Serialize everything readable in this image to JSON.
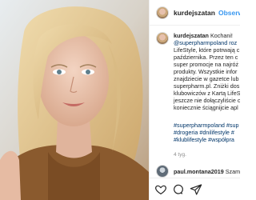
{
  "post": {
    "username": "kurdejszatan",
    "follow_label": "Obserw"
  },
  "caption": {
    "username": "kurdejszatan",
    "lines": [
      "Kochani!",
      "@superpharmpoland roz",
      "LifeStyle, które potrwają c",
      "października. Przez ten c",
      "super promocje na najróż",
      "produkty. Wszystkie infor",
      "znajdziecie w gazetce lub",
      "superpharm.pl. Zniżki dos",
      "klubowiczów z Kartą LifeS",
      "jeszcze nie dołączyliście c",
      "koniecznie ściągnijcie apl"
    ]
  },
  "hashtags": [
    "#superpharmpoland #sup",
    "#drogeria #dnilifestyle #",
    "#klublifestyle #współpra"
  ],
  "time_ago": "4 tyg.",
  "comment": {
    "username": "paul.montana2019",
    "text": "Szam"
  },
  "colors": {
    "link": "#003569",
    "follow": "#3897f0",
    "meta": "#8e8e8e"
  }
}
